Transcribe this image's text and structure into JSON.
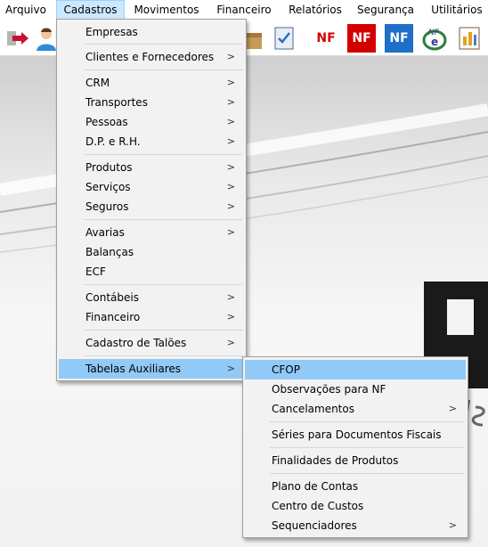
{
  "menubar": {
    "items": [
      "Arquivo",
      "Cadastros",
      "Movimentos",
      "Financeiro",
      "Relatórios",
      "Segurança",
      "Utilitários"
    ]
  },
  "toolbar": {
    "nf_label": "NF",
    "nfe_label": "NF"
  },
  "cadastros_menu": {
    "items": [
      {
        "label": "Empresas",
        "submenu": false
      },
      {
        "label": "Clientes e Fornecedores",
        "submenu": true
      },
      {
        "label": "CRM",
        "submenu": true
      },
      {
        "label": "Transportes",
        "submenu": true
      },
      {
        "label": "Pessoas",
        "submenu": true
      },
      {
        "label": "D.P. e R.H.",
        "submenu": true
      },
      {
        "label": "Produtos",
        "submenu": true
      },
      {
        "label": "Serviços",
        "submenu": true
      },
      {
        "label": "Seguros",
        "submenu": true
      },
      {
        "label": "Avarias",
        "submenu": true
      },
      {
        "label": "Balanças",
        "submenu": false
      },
      {
        "label": "ECF",
        "submenu": false
      },
      {
        "label": "Contábeis",
        "submenu": true
      },
      {
        "label": "Financeiro",
        "submenu": true
      },
      {
        "label": "Cadastro de Talões",
        "submenu": true
      },
      {
        "label": "Tabelas Auxiliares",
        "submenu": true
      }
    ]
  },
  "tabelas_submenu": {
    "items": [
      {
        "label": "CFOP",
        "submenu": false
      },
      {
        "label": "Observações para NF",
        "submenu": false
      },
      {
        "label": "Cancelamentos",
        "submenu": true
      },
      {
        "label": "Séries para Documentos Fiscais",
        "submenu": false
      },
      {
        "label": "Finalidades de Produtos",
        "submenu": false
      },
      {
        "label": "Plano de Contas",
        "submenu": false
      },
      {
        "label": "Centro de Custos",
        "submenu": false
      },
      {
        "label": "Sequenciadores",
        "submenu": true
      }
    ]
  },
  "colors": {
    "highlight": "#91c9f7",
    "menubar_open": "#cce8ff",
    "nf_red": "#d40000",
    "nf_blue": "#1e6fc8"
  },
  "icons": [
    "exit-arrow-icon",
    "user-icon",
    "box-icon",
    "checklist-icon",
    "nf-icon",
    "nf-red-icon",
    "nf-blue-icon",
    "nfe-icon",
    "report-icon"
  ]
}
